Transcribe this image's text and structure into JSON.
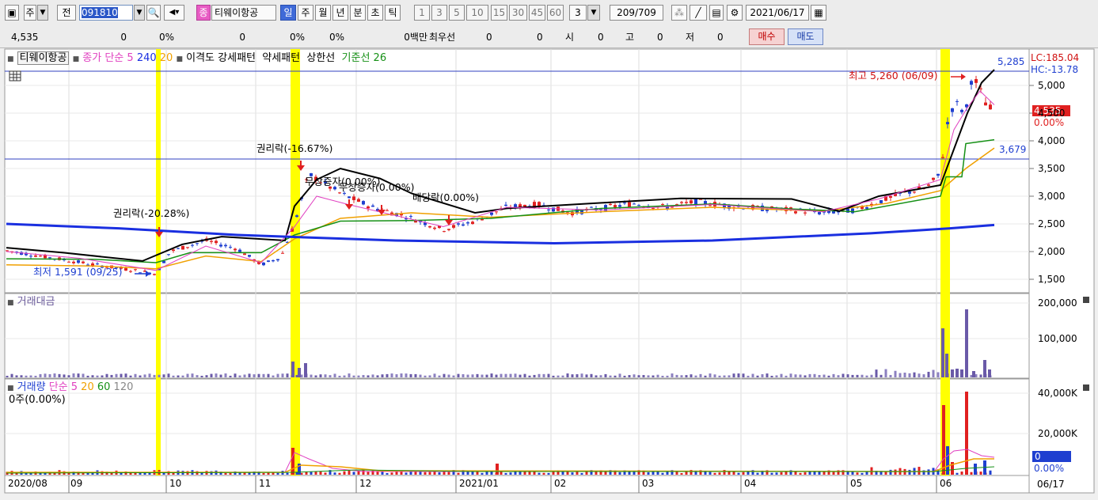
{
  "toolbar": {
    "period_prefix": "주",
    "prev_label": "전",
    "stock_code": "091810",
    "badge": "종",
    "stock_name": "티웨이항공",
    "period_tabs": [
      "일",
      "주",
      "월",
      "년",
      "분",
      "초",
      "틱"
    ],
    "active_period": "일",
    "interval_buttons": [
      "1",
      "3",
      "5",
      "10",
      "15",
      "30",
      "45",
      "60"
    ],
    "interval_value": "3",
    "count_value": "209",
    "count_total": "/709",
    "date_value": "2021/06/17"
  },
  "infobar": {
    "values": [
      "4,535",
      "0",
      "0%",
      "0",
      "0%",
      "0%"
    ],
    "vol_label": "0백만",
    "best_label": "최우선",
    "best_values": [
      "0",
      "0"
    ],
    "ohlc": [
      {
        "label": "시",
        "value": "0"
      },
      {
        "label": "고",
        "value": "0"
      },
      {
        "label": "저",
        "value": "0"
      }
    ],
    "buy_label": "매수",
    "sell_label": "매도"
  },
  "legend_price": {
    "name": "티웨이항공",
    "close_label": "종가 단순",
    "ma": [
      "5",
      "240",
      "20"
    ],
    "disparity_label": "이격도",
    "strong_label": "강세패턴",
    "weak_label": "약세패턴",
    "limit_label": "상한선",
    "base_label": "기준선 26"
  },
  "legend_amount": {
    "label": "거래대금"
  },
  "legend_volume": {
    "label": "거래량",
    "ma_label": "단순",
    "ma": [
      "5",
      "20",
      "60",
      "120"
    ],
    "current": "0주(0.00%)"
  },
  "annotations": {
    "high": "최고 5,260 (06/09)",
    "low": "최저 1,591 (09/25)",
    "events": [
      "권리락(-20.28%)",
      "권리락(-16.67%)",
      "무상증자(0.00%)",
      "무상증자(0.00%)",
      "배당락(0.00%)"
    ]
  },
  "price_axis": {
    "ticks": [
      "5,000",
      "4,500",
      "4,000",
      "3,500",
      "3,000",
      "2,500",
      "2,000",
      "1,500"
    ],
    "lc": "LC:185.04",
    "hc": "HC:-13.78",
    "level_top": "5,285",
    "level_mid": "3,679",
    "cur_price": "4,535",
    "cur_pct": "0.00%"
  },
  "amount_axis": {
    "ticks": [
      "200,000",
      "100,000"
    ]
  },
  "volume_axis": {
    "ticks": [
      "40,000K",
      "20,000K"
    ],
    "cur": "0",
    "cur_pct": "0.00%"
  },
  "date_axis": {
    "labels": [
      "2020/08",
      "09",
      "10",
      "11",
      "12",
      "2021/01",
      "02",
      "03",
      "04",
      "05",
      "06"
    ],
    "current": "06/17"
  },
  "colors": {
    "up": "#e02020",
    "down": "#1f3fd0",
    "ma5": "#e040c0",
    "ma20": "#f0a000",
    "ma240": "#1a2fe0",
    "base": "#159015",
    "highlight": "#ffff00"
  }
}
